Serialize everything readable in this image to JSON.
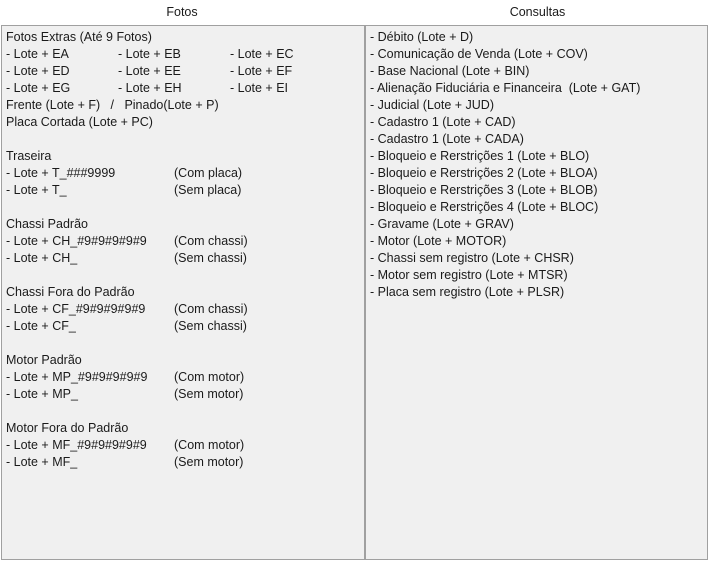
{
  "headers": {
    "fotos": "Fotos",
    "consultas": "Consultas"
  },
  "fotos": {
    "extras_title": "Fotos Extras (Até 9 Fotos)",
    "extras_grid": [
      [
        "- Lote + EA",
        "- Lote + EB",
        "- Lote + EC"
      ],
      [
        "- Lote + ED",
        "- Lote + EE",
        "- Lote + EF"
      ],
      [
        "- Lote + EG",
        "- Lote + EH",
        "- Lote + EI"
      ]
    ],
    "frente_pinado": "Frente (Lote + F)   /   Pinado(Lote + P)",
    "placa_cortada": "Placa Cortada (Lote + PC)",
    "sections": [
      {
        "title": "Traseira",
        "rows": [
          {
            "code": "- Lote + T_###9999",
            "desc": "(Com placa)"
          },
          {
            "code": "- Lote + T_",
            "desc": "(Sem placa)"
          }
        ]
      },
      {
        "title": "Chassi Padrão",
        "rows": [
          {
            "code": "- Lote + CH_#9#9#9#9#9",
            "desc": "(Com chassi)"
          },
          {
            "code": "- Lote + CH_",
            "desc": "(Sem chassi)"
          }
        ]
      },
      {
        "title": "Chassi Fora do Padrão",
        "rows": [
          {
            "code": "- Lote + CF_#9#9#9#9#9",
            "desc": "(Com chassi)"
          },
          {
            "code": "- Lote + CF_",
            "desc": "(Sem chassi)"
          }
        ]
      },
      {
        "title": "Motor Padrão",
        "rows": [
          {
            "code": "- Lote + MP_#9#9#9#9#9",
            "desc": "(Com motor)"
          },
          {
            "code": "- Lote + MP_",
            "desc": "(Sem motor)"
          }
        ]
      },
      {
        "title": "Motor Fora do Padrão",
        "rows": [
          {
            "code": "- Lote + MF_#9#9#9#9#9",
            "desc": "(Com motor)"
          },
          {
            "code": "- Lote + MF_",
            "desc": "(Sem motor)"
          }
        ]
      }
    ]
  },
  "consultas": {
    "items": [
      "- Débito (Lote + D)",
      "- Comunicação de Venda (Lote + COV)",
      "- Base Nacional (Lote + BIN)",
      "- Alienação Fiduciária e Financeira  (Lote + GAT)",
      "- Judicial (Lote + JUD)",
      "- Cadastro 1 (Lote + CAD)",
      "- Cadastro 1 (Lote + CADA)",
      "- Bloqueio e Rerstrições 1 (Lote + BLO)",
      "- Bloqueio e Rerstrições 2 (Lote + BLOA)",
      "- Bloqueio e Rerstrições 3 (Lote + BLOB)",
      "- Bloqueio e Rerstrições 4 (Lote + BLOC)",
      "- Gravame (Lote + GRAV)",
      "- Motor (Lote + MOTOR)",
      "- Chassi sem registro (Lote + CHSR)",
      "- Motor sem registro (Lote + MTSR)",
      "- Placa sem registro (Lote + PLSR)"
    ]
  }
}
